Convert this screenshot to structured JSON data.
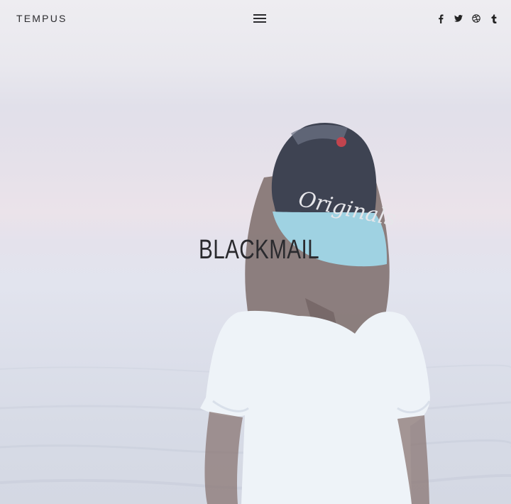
{
  "brand": {
    "name": "TEMPUS"
  },
  "menu": {
    "icon": "hamburger-menu-icon"
  },
  "social": [
    {
      "name": "facebook",
      "icon": "facebook-icon"
    },
    {
      "name": "twitter",
      "icon": "twitter-icon"
    },
    {
      "name": "dribbble",
      "icon": "dribbble-icon"
    },
    {
      "name": "tumblr",
      "icon": "tumblr-icon"
    }
  ],
  "hero": {
    "title": "BLACKMAIL",
    "cap_text": "Originals",
    "colors": {
      "sky_top": "#eeedf1",
      "sea": "#d7dbe6",
      "shirt": "#eef3f8",
      "cap_crown": "#3e4352",
      "cap_visor": "#9fd2e2",
      "hair": "#7d6c6a"
    }
  }
}
